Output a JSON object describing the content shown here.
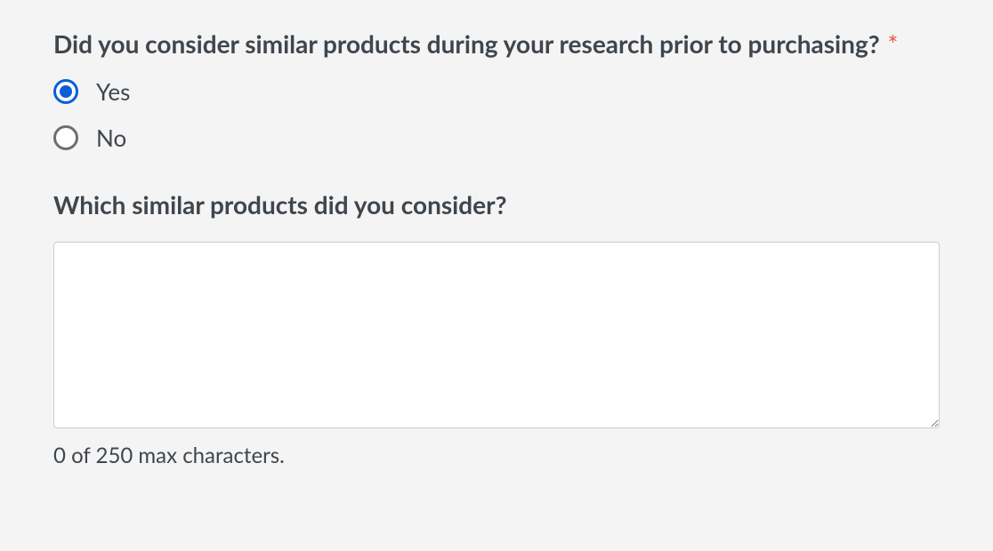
{
  "q1": {
    "label": "Did you consider similar products during your research prior to purchasing?",
    "required_marker": "*",
    "options": [
      {
        "label": "Yes",
        "selected": true
      },
      {
        "label": "No",
        "selected": false
      }
    ]
  },
  "q2": {
    "label": "Which similar products did you consider?",
    "value": "",
    "char_counter": "0 of 250 max characters."
  }
}
